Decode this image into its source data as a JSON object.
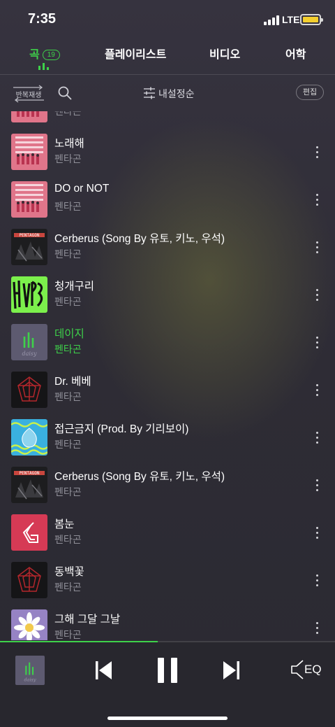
{
  "status": {
    "time": "7:35",
    "network": "LTE"
  },
  "tabs": [
    {
      "label": "곡",
      "count": "19",
      "active": true
    },
    {
      "label": "플레이리스트"
    },
    {
      "label": "비디오"
    },
    {
      "label": "어학"
    }
  ],
  "toolbar": {
    "repeat_label": "반복재생",
    "sort_label": "내설정순",
    "edit_label": "편집"
  },
  "songs": [
    {
      "title": "",
      "artist": "펜타곤",
      "art": "pink"
    },
    {
      "title": "노래해",
      "artist": "펜타곤",
      "art": "pink"
    },
    {
      "title": "DO or NOT",
      "artist": "펜타곤",
      "art": "pink"
    },
    {
      "title": "Cerberus (Song By 유토, 키노, 우석)",
      "artist": "펜타곤",
      "art": "dark-grunge"
    },
    {
      "title": "청개구리",
      "artist": "펜타곤",
      "art": "green"
    },
    {
      "title": "데이지",
      "artist": "펜타곤",
      "art": "daisy-purple",
      "playing": true
    },
    {
      "title": "Dr. 베베",
      "artist": "펜타곤",
      "art": "red-gem"
    },
    {
      "title": "접근금지 (Prod. By 기리보이)",
      "artist": "펜타곤",
      "art": "blue-wave"
    },
    {
      "title": "Cerberus (Song By 유토, 키노, 우석)",
      "artist": "펜타곤",
      "art": "dark-grunge"
    },
    {
      "title": "봄눈",
      "artist": "펜타곤",
      "art": "red-logo"
    },
    {
      "title": "동백꽃",
      "artist": "펜타곤",
      "art": "red-gem"
    },
    {
      "title": "그해 그달 그날",
      "artist": "펜타곤",
      "art": "flower-purple"
    }
  ],
  "player": {
    "progress": 0.47,
    "eq_label": "EQ",
    "album_art": "daisy-purple"
  },
  "colors": {
    "accent": "#3ed14a",
    "background": "#2f2d36",
    "muted_text": "#8f8f98"
  }
}
